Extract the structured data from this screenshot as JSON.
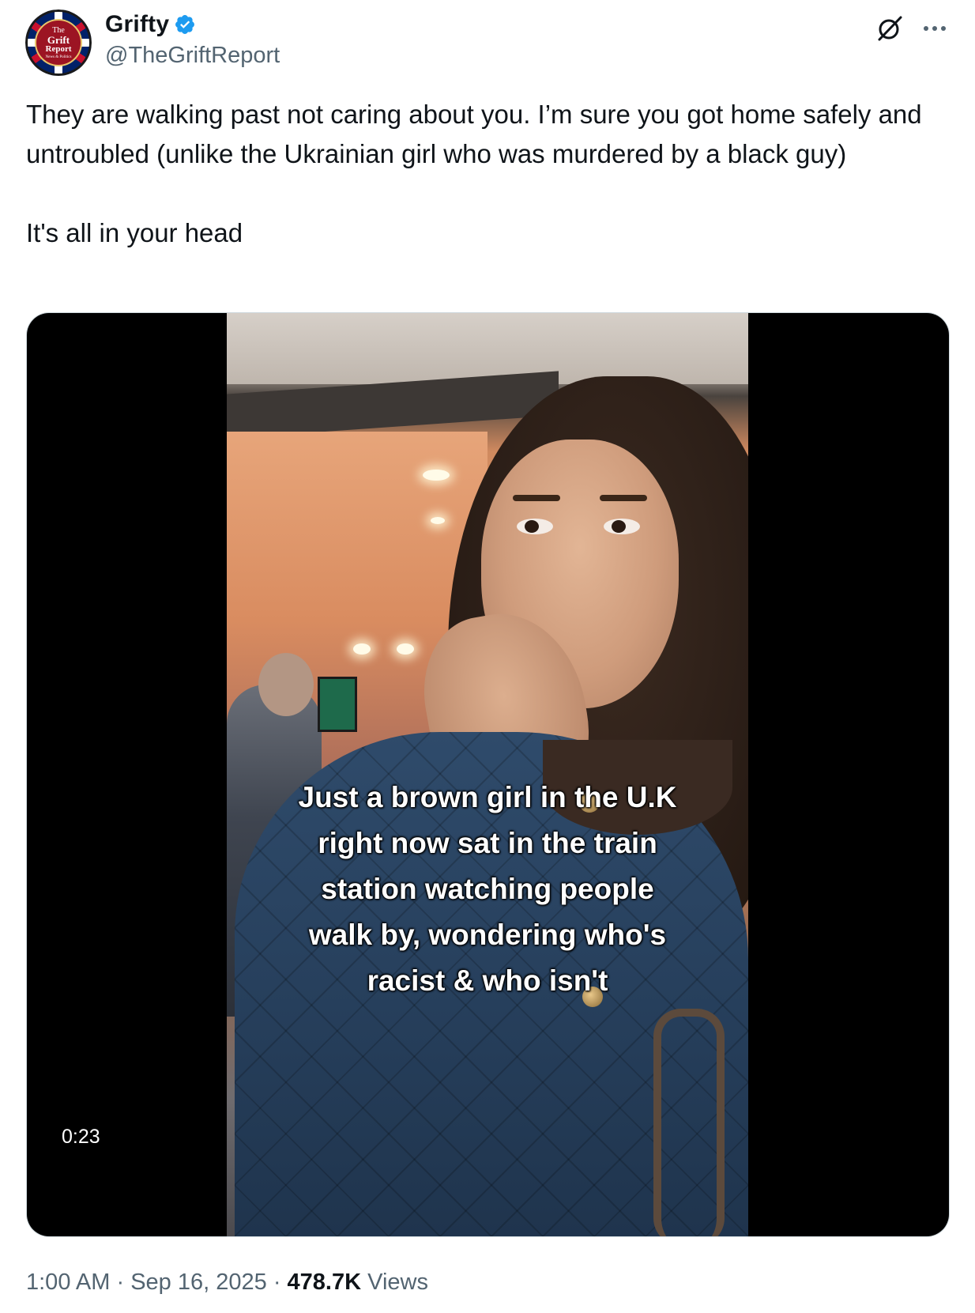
{
  "author": {
    "display_name": "Grifty",
    "handle": "@TheGriftReport",
    "verified": true,
    "avatar_text": [
      "The",
      "Grift",
      "Report",
      "News & Politics"
    ],
    "verified_color": "#1d9bf0"
  },
  "header_actions": {
    "grok_icon": "grok-icon",
    "more_icon": "more-icon"
  },
  "tweet": {
    "text": "They are walking past not caring about you. I’m sure you got home safely and untroubled (unlike the Ukrainian girl who was murdered by a black guy)\n\nIt's all in your head"
  },
  "video": {
    "caption": "Just a brown girl in the U.K\nright now sat in the train\nstation watching people\nwalk by, wondering who's\nracist & who isn't",
    "duration": "0:23"
  },
  "meta": {
    "time": "1:00 AM",
    "separator": "·",
    "date": "Sep 16, 2025",
    "views_count": "478.7K",
    "views_label": "Views"
  },
  "colors": {
    "text_primary": "#0f1419",
    "text_secondary": "#536471",
    "media_border": "#cfd9de"
  }
}
